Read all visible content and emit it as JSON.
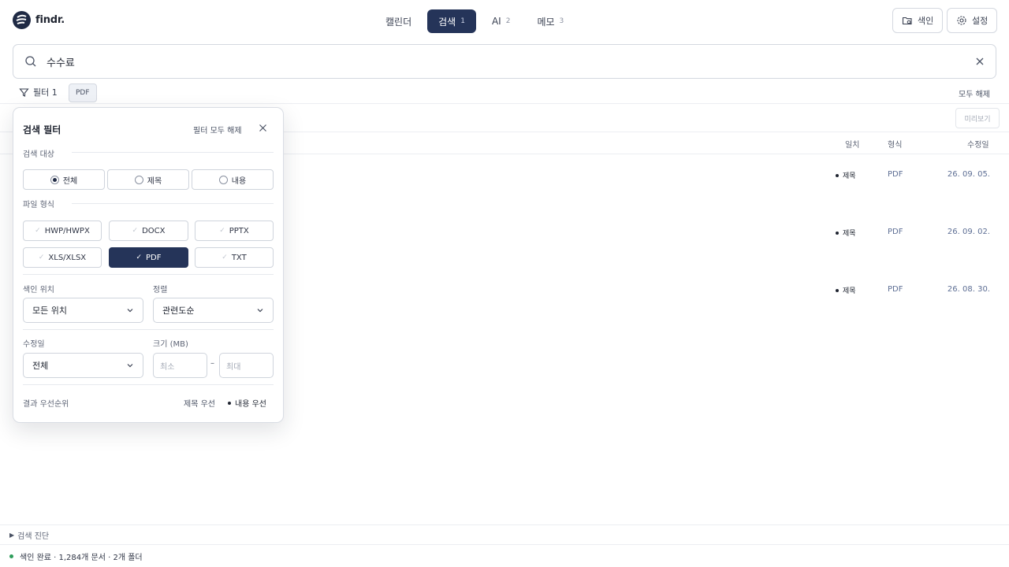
{
  "app": {
    "name": "findr."
  },
  "nav": {
    "tabs": [
      {
        "label": "캘린더",
        "count": ""
      },
      {
        "label": "검색",
        "count": "1"
      },
      {
        "label": "AI",
        "count": "2"
      },
      {
        "label": "메모",
        "count": "3"
      }
    ],
    "active": "검색"
  },
  "toolbar": {
    "index_label": "색인",
    "settings_label": "설정"
  },
  "search": {
    "value": "수수료"
  },
  "filters": {
    "toggle_label": "필터 1",
    "active_chip": "PDF",
    "clear_all": "모두 해제"
  },
  "results": {
    "preview_label": "미리보기",
    "columns": {
      "match": "일치",
      "type": "형식",
      "modified": "수정일"
    },
    "rows": [
      {
        "match": "제목",
        "type": "PDF",
        "date": "26. 09. 05."
      },
      {
        "match": "제목",
        "type": "PDF",
        "date": "26. 09. 02."
      },
      {
        "match": "제목",
        "type": "PDF",
        "date": "26. 08. 30."
      }
    ]
  },
  "panel": {
    "title": "검색 필터",
    "reset": "필터 모두 해제",
    "target_label": "검색 대상",
    "targets": [
      "전체",
      "제목",
      "내용"
    ],
    "target_selected": "전체",
    "format_label": "파일 형식",
    "formats": [
      "HWP/HWPX",
      "DOCX",
      "PPTX",
      "XLS/XLSX",
      "PDF",
      "TXT"
    ],
    "format_selected": "PDF",
    "location_label": "색인 위치",
    "location_value": "모든 위치",
    "sort_label": "정렬",
    "sort_value": "관련도순",
    "modified_label": "수정일",
    "modified_value": "전체",
    "size_label": "크기 (MB)",
    "size_min_placeholder": "최소",
    "size_max_placeholder": "최대",
    "size_sep": "–",
    "priority_label": "결과 우선순위",
    "priority_options": [
      "제목 우선",
      "내용 우선"
    ],
    "priority_selected": "내용 우선"
  },
  "footer": {
    "diagnostics": "검색 진단",
    "status": "색인 완료 · 1,284개 문서 · 2개 폴더"
  },
  "colors": {
    "accent": "#253459",
    "status_ok": "#2e9d5b"
  }
}
